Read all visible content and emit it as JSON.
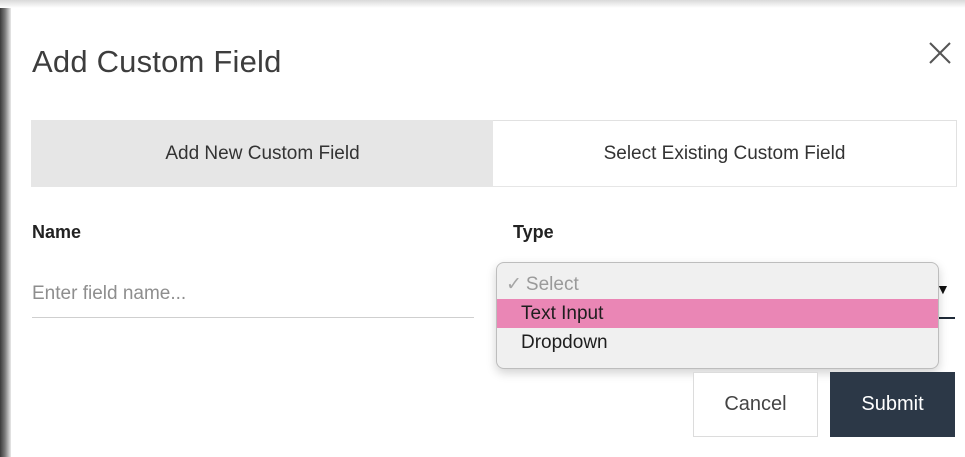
{
  "modal": {
    "title": "Add Custom Field",
    "close_icon": "close-icon"
  },
  "tabs": [
    {
      "label": "Add New Custom Field",
      "active": true
    },
    {
      "label": "Select Existing Custom Field",
      "active": false
    }
  ],
  "form": {
    "name": {
      "label": "Name",
      "placeholder": "Enter field name...",
      "value": ""
    },
    "type": {
      "label": "Type",
      "options": [
        {
          "label": "Select",
          "checked": true
        },
        {
          "label": "Text Input",
          "highlighted": true
        },
        {
          "label": "Dropdown"
        }
      ]
    }
  },
  "buttons": {
    "cancel": "Cancel",
    "submit": "Submit"
  },
  "colors": {
    "active_tab_bg": "#e6e6e6",
    "highlight": "#ea86b5",
    "submit_bg": "#2c3847"
  }
}
